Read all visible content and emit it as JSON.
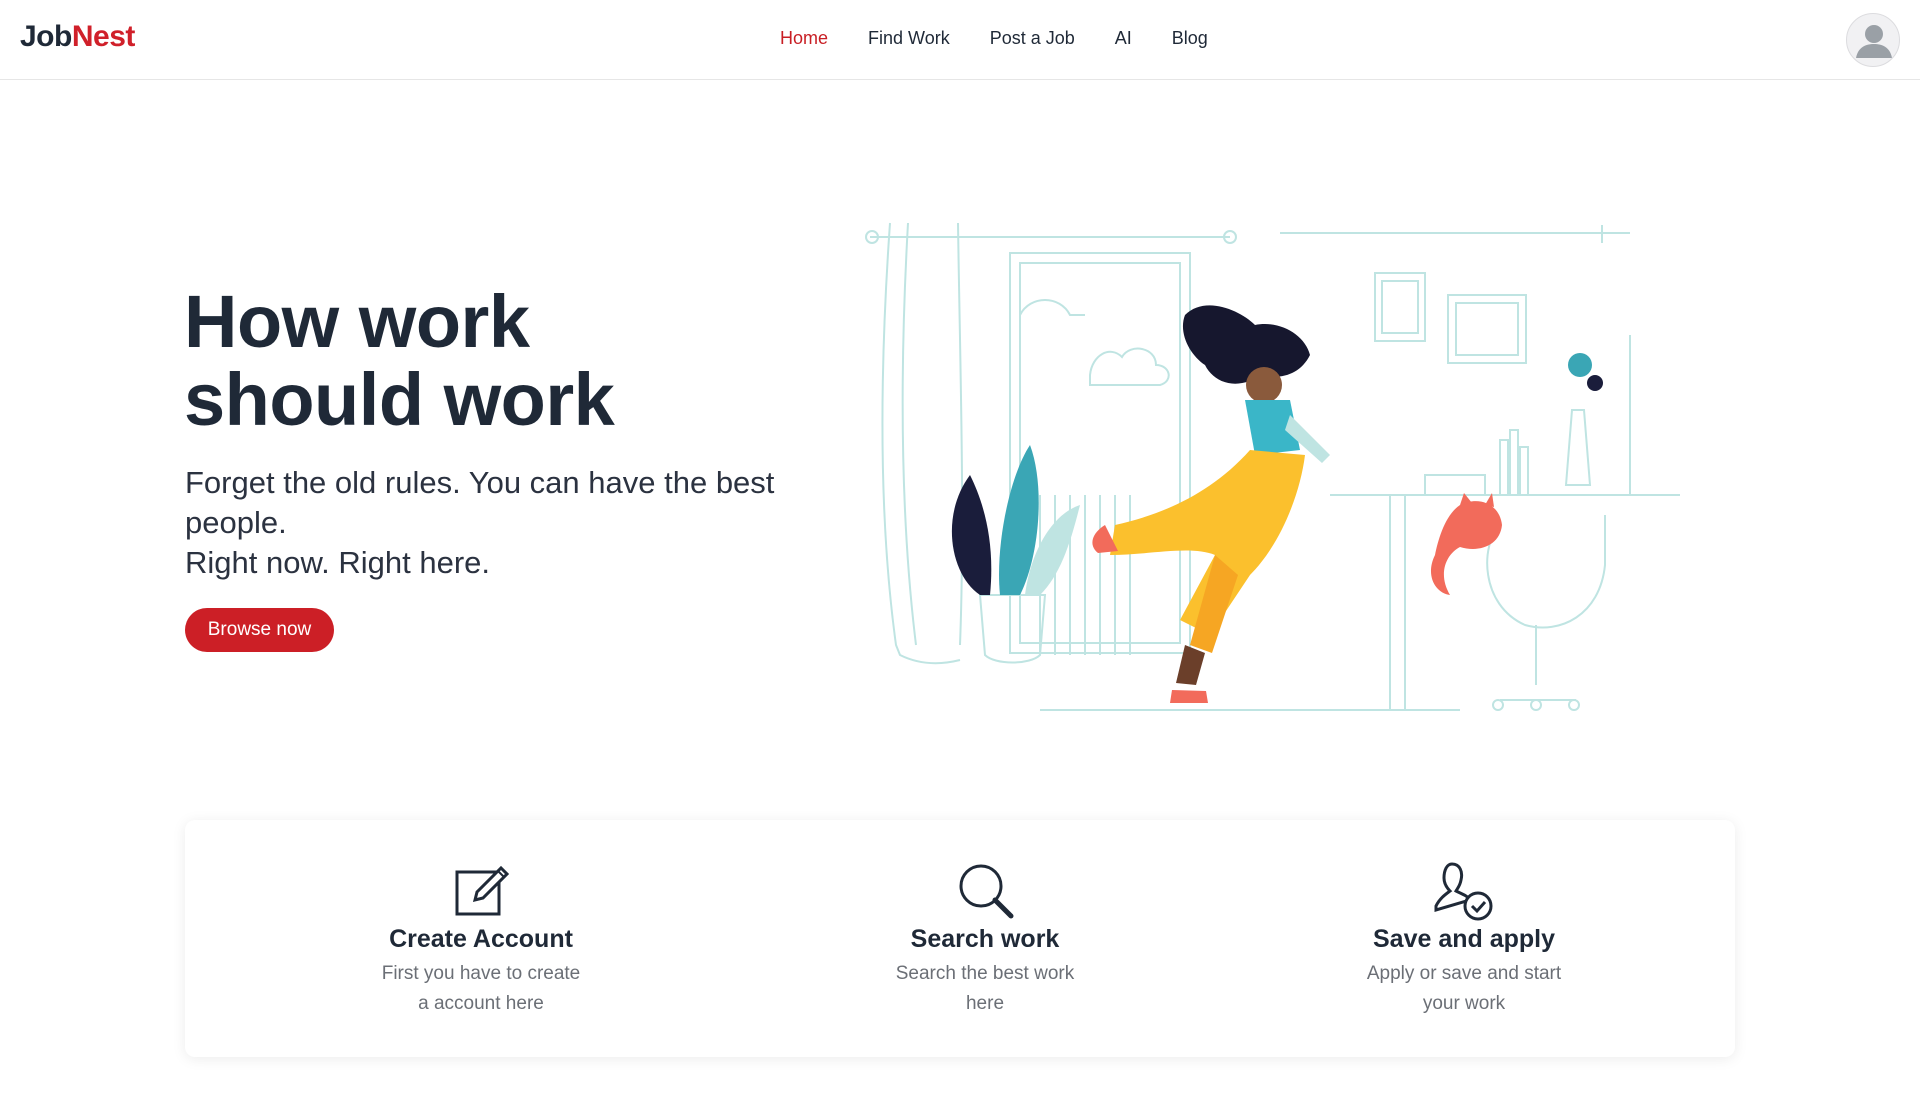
{
  "brand": {
    "part1": "Job",
    "part2": "Nest"
  },
  "nav": {
    "items": [
      {
        "label": "Home",
        "active": true
      },
      {
        "label": "Find Work",
        "active": false
      },
      {
        "label": "Post a Job",
        "active": false
      },
      {
        "label": "AI",
        "active": false
      },
      {
        "label": "Blog",
        "active": false
      }
    ]
  },
  "hero": {
    "title_line1": "How work",
    "title_line2": "should work",
    "subtitle_line1": "Forget the old rules. You can have the best people.",
    "subtitle_line2": "Right now. Right here.",
    "cta_label": "Browse now"
  },
  "features": [
    {
      "icon": "edit-icon",
      "title": "Create Account",
      "desc": "First you have to create a account here"
    },
    {
      "icon": "search-icon",
      "title": "Search work",
      "desc": "Search the best work here"
    },
    {
      "icon": "user-check-icon",
      "title": "Save and apply",
      "desc": "Apply or save and start your work"
    }
  ],
  "colors": {
    "accent": "#cc1f26",
    "text": "#1f2937",
    "muted": "#6b6f76",
    "illustration_line": "#bfe4e2"
  }
}
